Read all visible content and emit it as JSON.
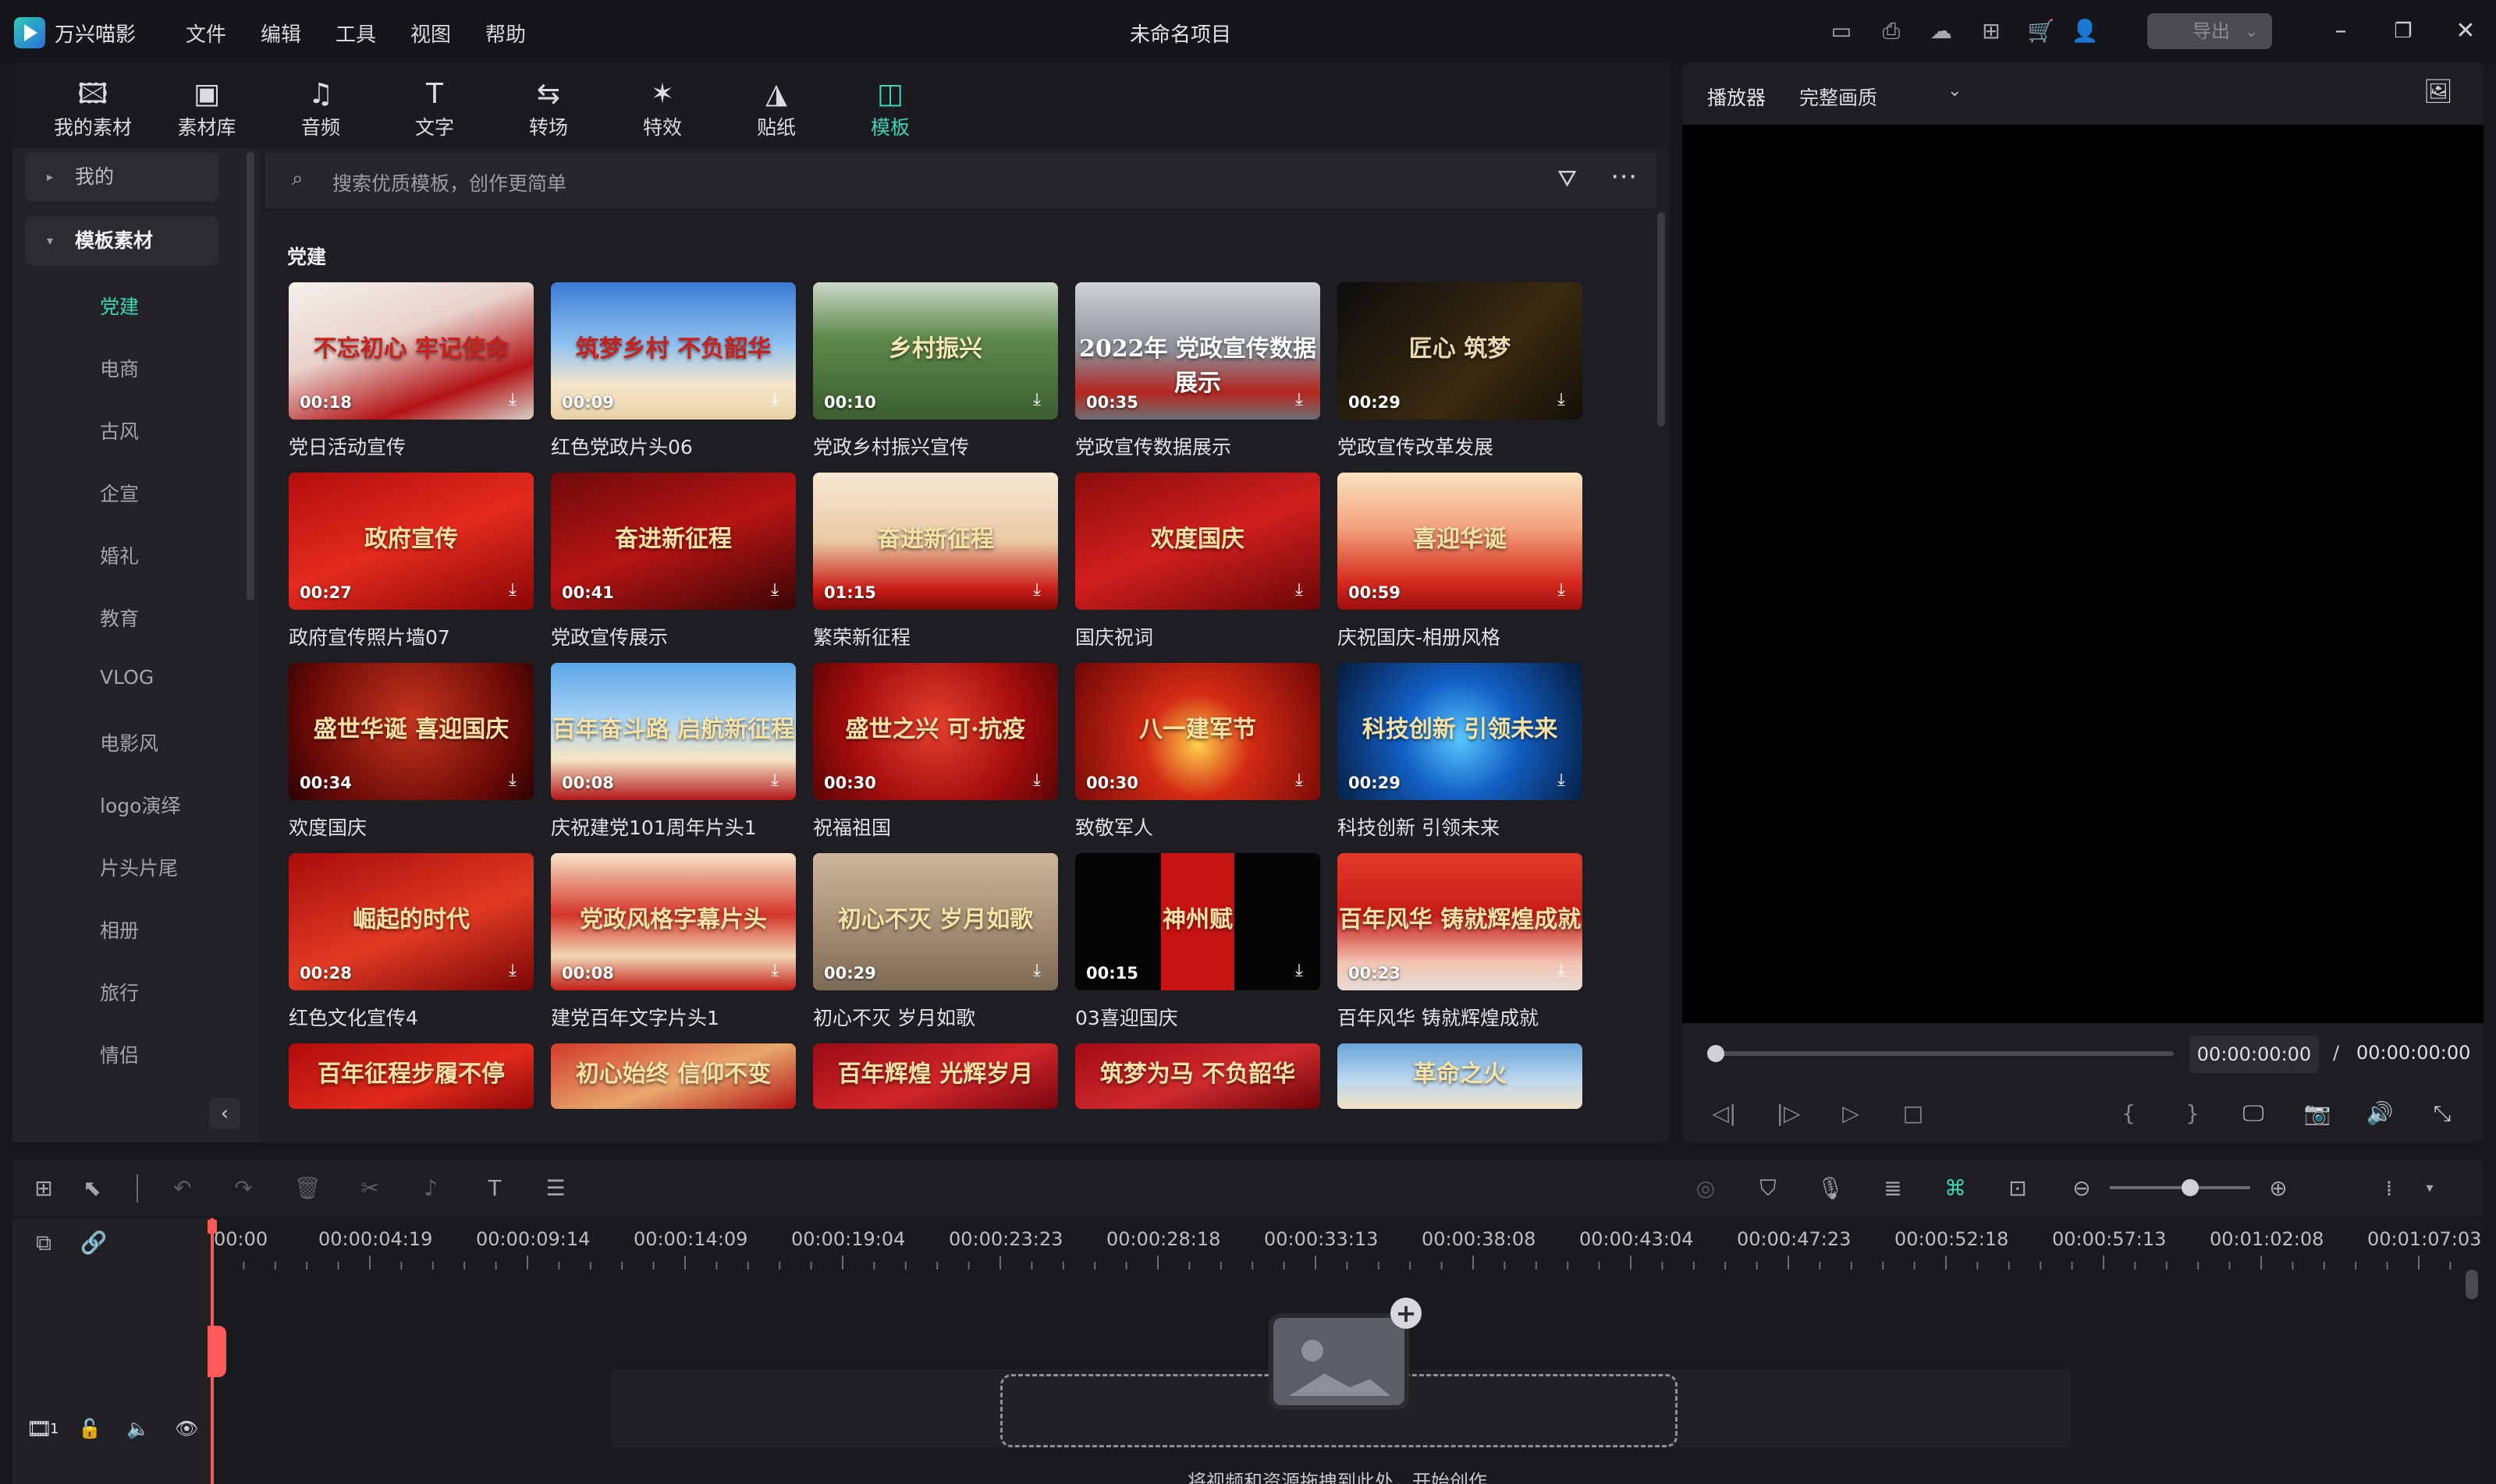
{
  "app": {
    "name": "万兴喵影",
    "menu": [
      "文件",
      "编辑",
      "工具",
      "视图",
      "帮助"
    ],
    "project_title": "未命名项目",
    "export_label": "导出",
    "accent_color": "#3dd6b6"
  },
  "top_tabs": [
    {
      "label": "我的素材",
      "icon": "my-media-icon",
      "glyph": "🖾"
    },
    {
      "label": "素材库",
      "icon": "stock-library-icon",
      "glyph": "▣"
    },
    {
      "label": "音频",
      "icon": "music-note-icon",
      "glyph": "♫"
    },
    {
      "label": "文字",
      "icon": "text-t-icon",
      "glyph": "T"
    },
    {
      "label": "转场",
      "icon": "transition-icon",
      "glyph": "⇆"
    },
    {
      "label": "特效",
      "icon": "sparkle-icon",
      "glyph": "✶"
    },
    {
      "label": "贴纸",
      "icon": "sticker-icon",
      "glyph": "◮"
    },
    {
      "label": "模板",
      "icon": "template-icon",
      "glyph": "◫",
      "active": true
    }
  ],
  "sidebar": {
    "mine": "我的",
    "template_assets": "模板素材",
    "categories": [
      "党建",
      "电商",
      "古风",
      "企宣",
      "婚礼",
      "教育",
      "VLOG",
      "电影风",
      "logo演绎",
      "片头片尾",
      "相册",
      "旅行",
      "情侣"
    ],
    "active_category": "党建"
  },
  "search": {
    "placeholder": "搜索优质模板，创作更简单"
  },
  "section_title": "党建",
  "templates": [
    {
      "name": "党日活动宣传",
      "duration": "00:18",
      "art": "不忘初心 牢记使命"
    },
    {
      "name": "红色党政片头06",
      "duration": "00:09",
      "art": "筑梦乡村 不负韶华"
    },
    {
      "name": "党政乡村振兴宣传",
      "duration": "00:10",
      "art": "乡村振兴"
    },
    {
      "name": "党政宣传数据展示",
      "duration": "00:35",
      "art": "2022年 党政宣传数据展示"
    },
    {
      "name": "党政宣传改革发展",
      "duration": "00:29",
      "art": "匠心 筑梦"
    },
    {
      "name": "政府宣传照片墙07",
      "duration": "00:27",
      "art": "政府宣传"
    },
    {
      "name": "党政宣传展示",
      "duration": "00:41",
      "art": "奋进新征程"
    },
    {
      "name": "繁荣新征程",
      "duration": "01:15",
      "art": "奋进新征程"
    },
    {
      "name": "国庆祝词",
      "duration": "",
      "art": "欢度国庆"
    },
    {
      "name": "庆祝国庆-相册风格",
      "duration": "00:59",
      "art": "喜迎华诞"
    },
    {
      "name": "欢度国庆",
      "duration": "00:34",
      "art": "盛世华诞 喜迎国庆"
    },
    {
      "name": "庆祝建党101周年片头1",
      "duration": "00:08",
      "art": "百年奋斗路 启航新征程"
    },
    {
      "name": "祝福祖国",
      "duration": "00:30",
      "art": "盛世之兴 可·抗疫"
    },
    {
      "name": "致敬军人",
      "duration": "00:30",
      "art": "八一建军节"
    },
    {
      "name": "科技创新 引领未来",
      "duration": "00:29",
      "art": "科技创新 引领未来"
    },
    {
      "name": "红色文化宣传4",
      "duration": "00:28",
      "art": "崛起的时代"
    },
    {
      "name": "建党百年文字片头1",
      "duration": "00:08",
      "art": "党政风格字幕片头"
    },
    {
      "name": "初心不灭 岁月如歌",
      "duration": "00:29",
      "art": "初心不灭 岁月如歌"
    },
    {
      "name": "03喜迎国庆",
      "duration": "00:15",
      "art": "神州赋"
    },
    {
      "name": "百年风华 铸就辉煌成就",
      "duration": "00:23",
      "art": "百年风华 铸就辉煌成就"
    },
    {
      "name": "",
      "duration": "",
      "art": "百年征程步履不停"
    },
    {
      "name": "",
      "duration": "",
      "art": "初心始终 信仰不变"
    },
    {
      "name": "",
      "duration": "",
      "art": "百年辉煌 光辉岁月"
    },
    {
      "name": "",
      "duration": "",
      "art": "筑梦为马 不负韶华"
    },
    {
      "name": "",
      "duration": "",
      "art": "革命之火"
    }
  ],
  "player": {
    "title": "播放器",
    "quality": "完整画质",
    "current_time": "00:00:00:00",
    "separator": "/",
    "total_time": "00:00:00:00"
  },
  "timeline": {
    "ticks": [
      "00:00",
      "00:00:04:19",
      "00:00:09:14",
      "00:00:14:09",
      "00:00:19:04",
      "00:00:23:23",
      "00:00:28:18",
      "00:00:33:13",
      "00:00:38:08",
      "00:00:43:04",
      "00:00:47:23",
      "00:00:52:18",
      "00:00:57:13",
      "00:01:02:08",
      "00:01:07:03"
    ],
    "track_number": "1",
    "drop_hint": "将视频和资源拖拽到此处，开始创作"
  }
}
